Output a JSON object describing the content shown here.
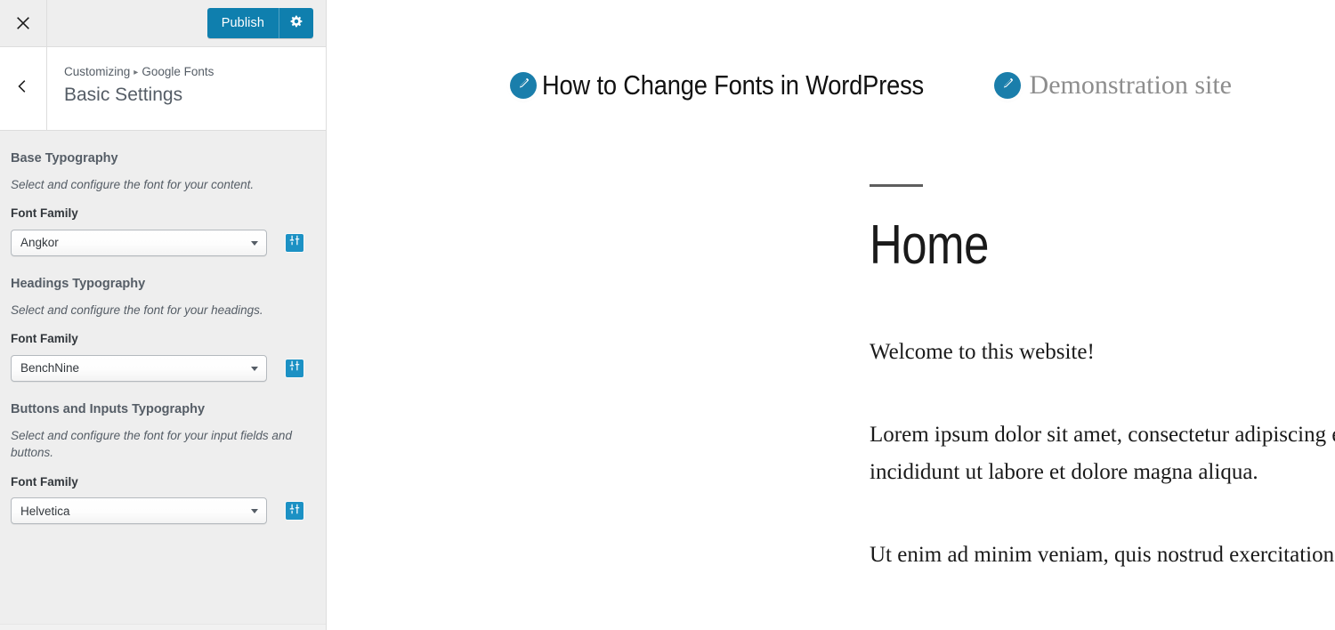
{
  "sidebar": {
    "close_label": "close-customizer",
    "publish": {
      "label": "Publish",
      "gear_label": "publish-settings",
      "color": "#0f7fae"
    },
    "back_label": "back",
    "breadcrumb": {
      "prefix": "Customizing",
      "separator": "▸",
      "parent": "Google Fonts"
    },
    "section_title": "Basic Settings",
    "groups": [
      {
        "title": "Base Typography",
        "description": "Select and configure the font for your content.",
        "field_label": "Font Family",
        "value": "Angkor",
        "adjust_icon": "sliders-icon"
      },
      {
        "title": "Headings Typography",
        "description": "Select and configure the font for your headings.",
        "field_label": "Font Family",
        "value": "BenchNine",
        "adjust_icon": "sliders-icon"
      },
      {
        "title": "Buttons and Inputs Typography",
        "description": "Select and configure the font for your input fields and buttons.",
        "field_label": "Font Family",
        "value": "Helvetica",
        "adjust_icon": "sliders-icon"
      }
    ]
  },
  "preview": {
    "site_title": "How to Change Fonts in WordPress",
    "site_tagline": "Demonstration site",
    "edit_icon": "pencil-edit-icon",
    "edit_pin_color": "#1a7eab",
    "entry": {
      "title": "Home",
      "paragraphs": [
        "Welcome to this website!",
        "Lorem ipsum dolor sit amet, consectetur adipiscing elit, sed do eiusmod tempor incididunt ut labore et dolore magna aliqua.",
        "Ut enim ad minim veniam, quis nostrud exercitation ullamco laboris nisi"
      ]
    }
  }
}
